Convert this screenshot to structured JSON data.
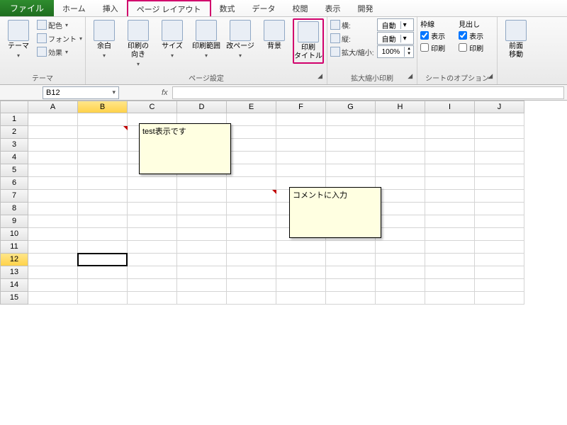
{
  "tabs": {
    "file": "ファイル",
    "items": [
      "ホーム",
      "挿入",
      "ページ レイアウト",
      "数式",
      "データ",
      "校閲",
      "表示",
      "開発"
    ],
    "active_index": 2
  },
  "ribbon": {
    "themes": {
      "theme": "テーマ",
      "colors": "配色",
      "fonts": "フォント",
      "effects": "効果",
      "label": "テーマ"
    },
    "page_setup": {
      "margins": "余白",
      "orientation": "印刷の\n向き",
      "size": "サイズ",
      "print_area": "印刷範囲",
      "breaks": "改ページ",
      "background": "背景",
      "print_titles": "印刷\nタイトル",
      "label": "ページ設定"
    },
    "scale": {
      "width_lbl": "横:",
      "height_lbl": "縦:",
      "scale_lbl": "拡大/縮小:",
      "width_val": "自動",
      "height_val": "自動",
      "scale_val": "100%",
      "label": "拡大縮小印刷"
    },
    "sheet_opts": {
      "gridlines": "枠線",
      "headings": "見出し",
      "view": "表示",
      "print": "印刷",
      "label": "シートのオプション"
    },
    "arrange": {
      "bring_front": "前面\n移動"
    }
  },
  "namebox": "B12",
  "fx_label": "fx",
  "columns": [
    "A",
    "B",
    "C",
    "D",
    "E",
    "F",
    "G",
    "H",
    "I",
    "J"
  ],
  "rows": [
    "1",
    "2",
    "3",
    "4",
    "5",
    "6",
    "7",
    "8",
    "9",
    "10",
    "11",
    "12",
    "13",
    "14",
    "15"
  ],
  "selected_col_index": 1,
  "selected_row_index": 11,
  "comments": {
    "c1_text": "test表示です",
    "c2_text": "コメントに入力"
  }
}
